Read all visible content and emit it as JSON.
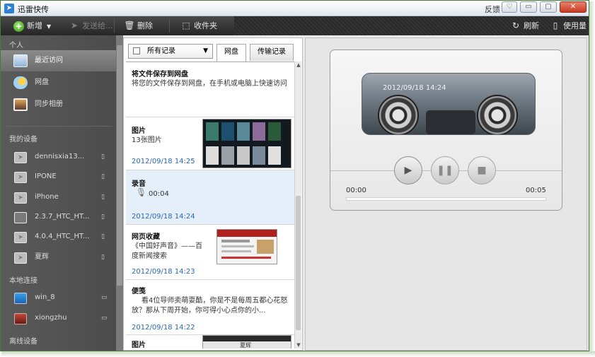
{
  "window": {
    "title": "迅雷快传",
    "feedback": "反馈",
    "controls": {
      "settings": "♡",
      "minimize": "▭",
      "maximize": "▢",
      "close": "✕"
    }
  },
  "toolbar": {
    "new": "新增",
    "send": "发送给...",
    "delete": "删除",
    "favorites": "收件夹",
    "refresh": "刷新",
    "usage": "使用量"
  },
  "sidebar": {
    "sections": {
      "personal": "个人",
      "devices": "我的设备",
      "local": "本地连接",
      "offline": "离线设备"
    },
    "personal_items": [
      {
        "label": "最近访问"
      },
      {
        "label": "网盘"
      },
      {
        "label": "同步相册"
      }
    ],
    "device_items": [
      {
        "label": "dennisxia13..."
      },
      {
        "label": "IPONE"
      },
      {
        "label": "iPhone"
      },
      {
        "label": "2.3.7_HTC_HT..."
      },
      {
        "label": "4.0.4_HTC_HT..."
      },
      {
        "label": "夏辉"
      }
    ],
    "local_items": [
      {
        "label": "win_8"
      },
      {
        "label": "xiongzhu"
      }
    ]
  },
  "list_panel": {
    "filter_label": "所有记录",
    "tabs": [
      {
        "label": "网盘"
      },
      {
        "label": "传输记录"
      }
    ],
    "cards": [
      {
        "title": "将文件保存到网盘",
        "text": "将您的文件保存到网盘，在手机或电脑上快速访问",
        "date": ""
      },
      {
        "title": "图片",
        "text": "13张图片",
        "date": "2012/09/18  14:25"
      },
      {
        "title": "录音",
        "text": "00:04",
        "date": "2012/09/18  14:24"
      },
      {
        "title": "网页收藏",
        "text": "《中国好声音》——百度新闻搜索",
        "date": "2012/09/18  14:23"
      },
      {
        "title": "便笺",
        "text": "看4位导师卖萌耍酷，你是不是每周五都心花怒放？那从下周开始，你可得小心点你的小...",
        "date": "2012/09/18  14:22"
      },
      {
        "title": "图片",
        "text": "",
        "date": ""
      }
    ],
    "thumb_caption": "夏辉"
  },
  "player": {
    "date": "2012/09/18  14:24",
    "time_start": "00:00",
    "time_end": "00:05",
    "progress_fraction": 0
  }
}
